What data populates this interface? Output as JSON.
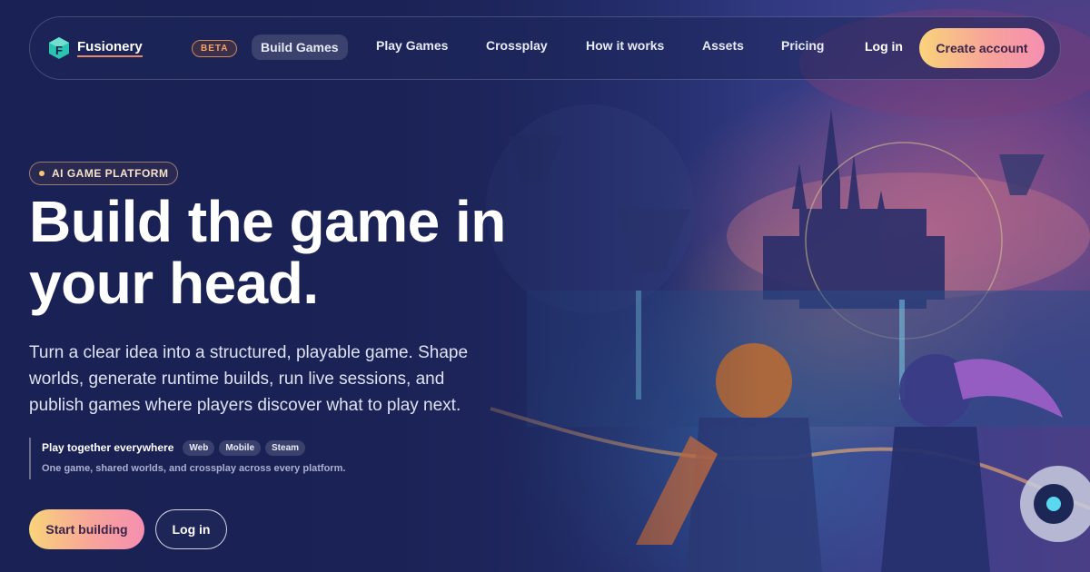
{
  "brand": {
    "name": "Fusionery",
    "beta_label": "BETA",
    "accent_gradient": [
      "#f9d47a",
      "#f58fb1"
    ],
    "background": "#1b2250"
  },
  "nav": {
    "items": [
      {
        "label": "Build Games",
        "active": true
      },
      {
        "label": "Play Games",
        "active": false
      },
      {
        "label": "Crossplay",
        "active": false
      },
      {
        "label": "How it works",
        "active": false
      },
      {
        "label": "Assets",
        "active": false
      },
      {
        "label": "Pricing",
        "active": false
      }
    ],
    "login_label": "Log in",
    "create_account_label": "Create account"
  },
  "hero": {
    "badge": "AI GAME PLATFORM",
    "headline_line1": "Build the game in",
    "headline_line2": "your head.",
    "subtext": "Turn a clear idea into a structured, playable game. Shape worlds, generate runtime builds, run live sessions, and publish games where players discover what to play next.",
    "platforms": {
      "title": "Play together everywhere",
      "chips": [
        "Web",
        "Mobile",
        "Steam"
      ],
      "description": "One game, shared worlds, and crossplay across every platform."
    },
    "primary_cta": "Start building",
    "secondary_cta": "Log in"
  }
}
